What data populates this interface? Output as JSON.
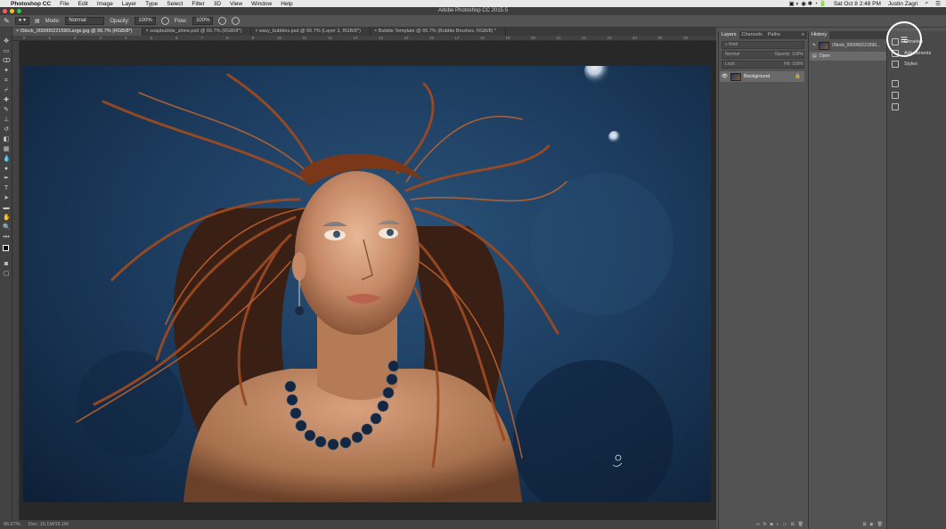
{
  "menubar": {
    "apple": "",
    "app": "Photoshop CC",
    "items": [
      "File",
      "Edit",
      "Image",
      "Layer",
      "Type",
      "Select",
      "Filter",
      "3D",
      "View",
      "Window",
      "Help"
    ],
    "datetime": "Sat Oct 8  2:48 PM",
    "user": "Justin Zagri"
  },
  "window": {
    "title": "Adobe Photoshop CC 2015.5"
  },
  "options": {
    "mode_label": "Mode:",
    "mode_value": "Normal",
    "opacity_label": "Opacity:",
    "opacity_value": "100%",
    "flow_label": "Flow:",
    "flow_value": "100%"
  },
  "tabs": [
    {
      "label": "iStock_000000221590Large.jpg @ 66.7% (RGB/8*)"
    },
    {
      "label": "soapbubble_shine.psd @ 66.7% (RGB/8*)"
    },
    {
      "label": "easy_bubbles.psd @ 66.7% (Layer 3, RGB/8*)"
    },
    {
      "label": "Bubble Template @ 66.7% (Bubble Brushes, RGB/8) *"
    }
  ],
  "ruler_ticks": [
    "0",
    "1",
    "2",
    "3",
    "4",
    "5",
    "6",
    "7",
    "8",
    "9",
    "10",
    "11",
    "12",
    "13",
    "14",
    "15",
    "16",
    "17",
    "18",
    "19",
    "20",
    "21",
    "22",
    "23",
    "24",
    "25",
    "26"
  ],
  "status": {
    "zoom": "66.67%",
    "doc": "Doc: 16.1M/16.1M"
  },
  "layers_panel": {
    "tabs": [
      "Layers",
      "Channels",
      "Paths"
    ],
    "search_placeholder": "Kind",
    "blend_mode": "Normal",
    "opacity": "Opacity: 100%",
    "lock_label": "Lock:",
    "fill": "Fill: 100%",
    "layer_name": "Background"
  },
  "history_panel": {
    "tabs": [
      "History"
    ],
    "snapshot": "iStock_000000221590...",
    "step": "Open"
  },
  "dock": {
    "items": [
      "Libraries",
      "Adjustments",
      "Styles"
    ]
  },
  "colors": {
    "bg": "#535353",
    "canvas_bg": "#282828",
    "photo_blue": "#1d3d60",
    "highlight": "#ffffff"
  }
}
